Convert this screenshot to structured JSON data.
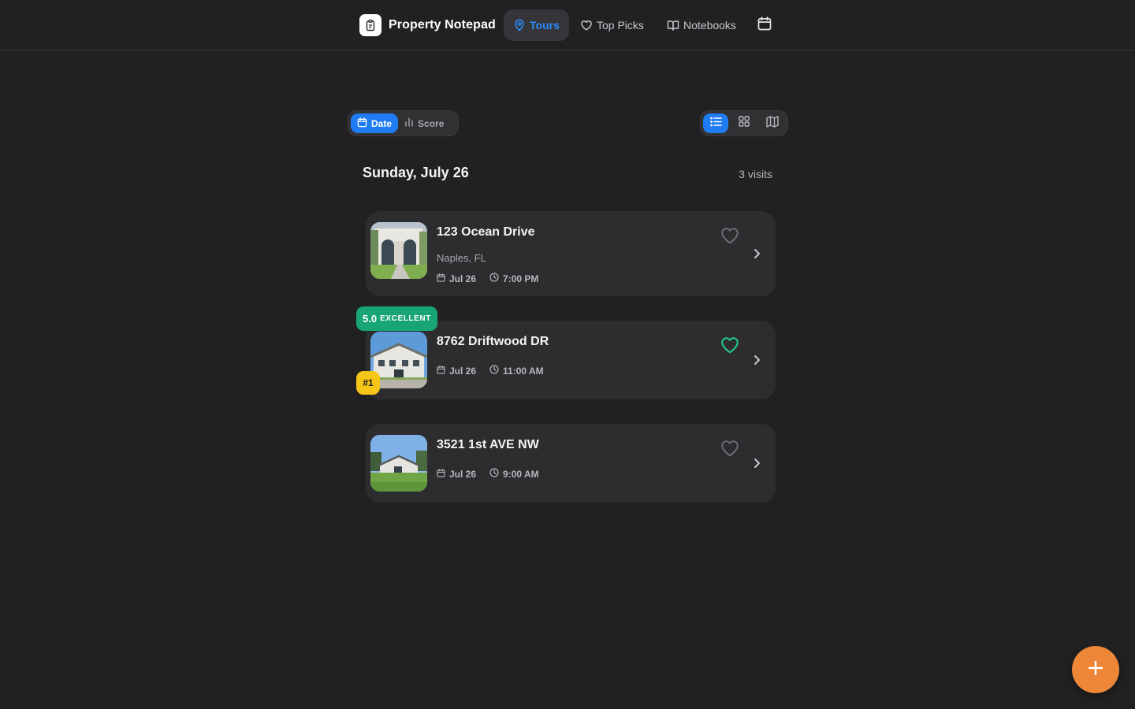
{
  "app": {
    "name": "Property Notepad",
    "colors": {
      "accent": "#1f7cf2",
      "success": "#17a673",
      "rank": "#f5c518",
      "fab": "#ee8637"
    }
  },
  "nav": {
    "tabs": [
      {
        "label": "Tours",
        "icon": "map-pin-icon",
        "active": true
      },
      {
        "label": "Top Picks",
        "icon": "heart-icon",
        "active": false
      },
      {
        "label": "Notebooks",
        "icon": "book-open-icon",
        "active": false
      }
    ],
    "calendar_icon": "calendar-icon"
  },
  "sort": {
    "options": [
      {
        "label": "Date",
        "icon": "calendar-icon",
        "active": true
      },
      {
        "label": "Score",
        "icon": "bar-chart-icon",
        "active": false
      }
    ]
  },
  "view_modes": [
    {
      "name": "list",
      "icon": "list-icon",
      "active": true
    },
    {
      "name": "grid",
      "icon": "grid-icon",
      "active": false
    },
    {
      "name": "map",
      "icon": "map-icon",
      "active": false
    }
  ],
  "group": {
    "title": "Sunday, July 26",
    "count": "3 visits"
  },
  "visits": [
    {
      "address": "123 Ocean Drive",
      "city": "Naples, FL",
      "date": "Jul 26",
      "time": "7:00 PM",
      "favorited": false
    },
    {
      "address": "8762 Driftwood DR",
      "date": "Jul 26",
      "time": "11:00 AM",
      "favorited": true,
      "score": "5.0",
      "score_label": "EXCELLENT",
      "rank": "#1"
    },
    {
      "address": "3521 1st AVE NW",
      "date": "Jul 26",
      "time": "9:00 AM",
      "favorited": false
    }
  ],
  "fab": {
    "icon": "plus-icon"
  }
}
